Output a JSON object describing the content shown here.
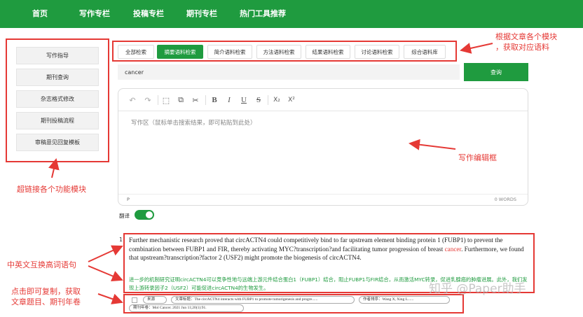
{
  "nav": {
    "items": [
      "首页",
      "写作专栏",
      "投稿专栏",
      "期刊专栏",
      "热门工具推荐"
    ]
  },
  "sidebar": {
    "items": [
      "写作指导",
      "期刊查询",
      "杂志格式修改",
      "期刊投稿流程",
      "审稿意见回复模板"
    ]
  },
  "search_tabs": {
    "items": [
      "全部检索",
      "摘要语料检索",
      "简介语料检索",
      "方法语料检索",
      "结果语料检索",
      "讨论语料检索",
      "综合语料库"
    ],
    "active": "摘要语料检索"
  },
  "search": {
    "query": "cancer",
    "button": "查询"
  },
  "editor": {
    "toolbar": {
      "undo": "↶",
      "redo": "↷",
      "select_all": "⬚",
      "copy": "⧉",
      "cut": "✂",
      "bold": "B",
      "italic": "I",
      "underline": "U",
      "strike": "S",
      "subscript": "X₂",
      "superscript": "X²"
    },
    "placeholder": "写作区（鼠标单击搜索结果，即可粘贴到此处）",
    "status_p": "P",
    "word_count": "0 WORDS"
  },
  "translate": {
    "label": "翻译",
    "enabled": true
  },
  "result": {
    "number": "1.",
    "en_before": "Further mechanistic research proved that circACTN4 could competitively bind to far upstream element binding protein 1 (FUBP1) to prevent the combination between FUBP1 and FIR, thereby activating MYC?transcription?and facilitating tumor progression of breast ",
    "en_keyword": "cancer",
    "en_after": ". Furthermore, we found that upstream?transcription?factor 2 (USF2) might promote the biogenesis of circACTN4.",
    "zh": "进一步的机制研究证明circACTN4可以竞争性地与远端上游元件结合蛋白1（FUBP1）结合，阻止FUBP1与FIR结合，从而激活MYC转录，促进乳腺癌的肿瘤进展。此外，我们发现上游转录因子2（USF2）可能促进circACTN4的生物发生。",
    "meta": {
      "source": "来源",
      "title": "文章标题：The circACTN4 interacts with FUBP1 to promote tumorigenesis and progre......",
      "authors": "作者排序：Wang X, Xing L......",
      "journal": "期刊年卷：Mol Cancer. 2021 Jun 11;20(1):91."
    }
  },
  "annotations": {
    "tabs": "根据文章各个模块\n，获取对应语料",
    "editor": "写作编辑框",
    "sidebar": "超链接各个功能模块",
    "bilingual": "中英文互换高词语句",
    "copy": "点击即可复制，获取\n文章题目、期刊年卷"
  },
  "watermark": "知乎 @Paper助手",
  "colors": {
    "brand_green": "#1f9b3f",
    "annotation_red": "#e53935"
  }
}
